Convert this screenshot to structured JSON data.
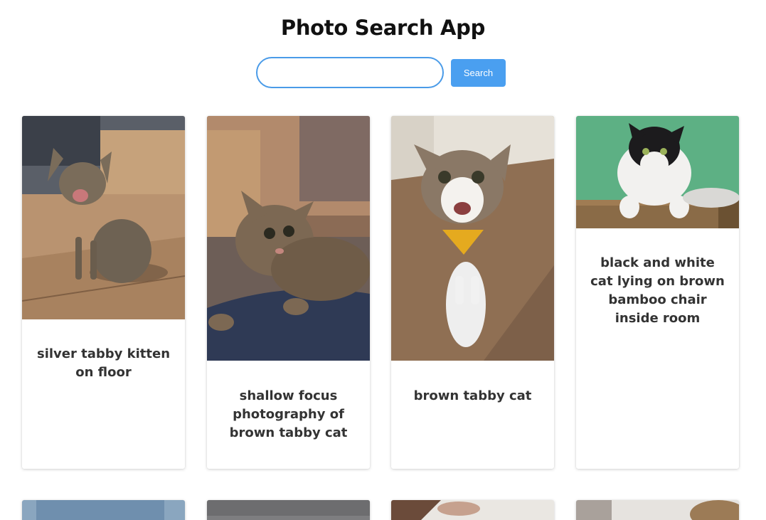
{
  "app": {
    "title": "Photo Search App"
  },
  "search": {
    "value": "",
    "placeholder": "",
    "button_label": "Search"
  },
  "results": [
    {
      "caption": "silver tabby kitten on floor",
      "icon": "kitten-photo"
    },
    {
      "caption": "shallow focus photography of brown tabby cat",
      "icon": "tabby-cat-photo"
    },
    {
      "caption": "brown tabby cat",
      "icon": "cat-bandana-photo"
    },
    {
      "caption": "black and white cat lying on brown bamboo chair inside room",
      "icon": "black-white-cat-photo"
    }
  ],
  "colors": {
    "accent": "#4a9ff0",
    "input_border": "#4a9be8"
  }
}
